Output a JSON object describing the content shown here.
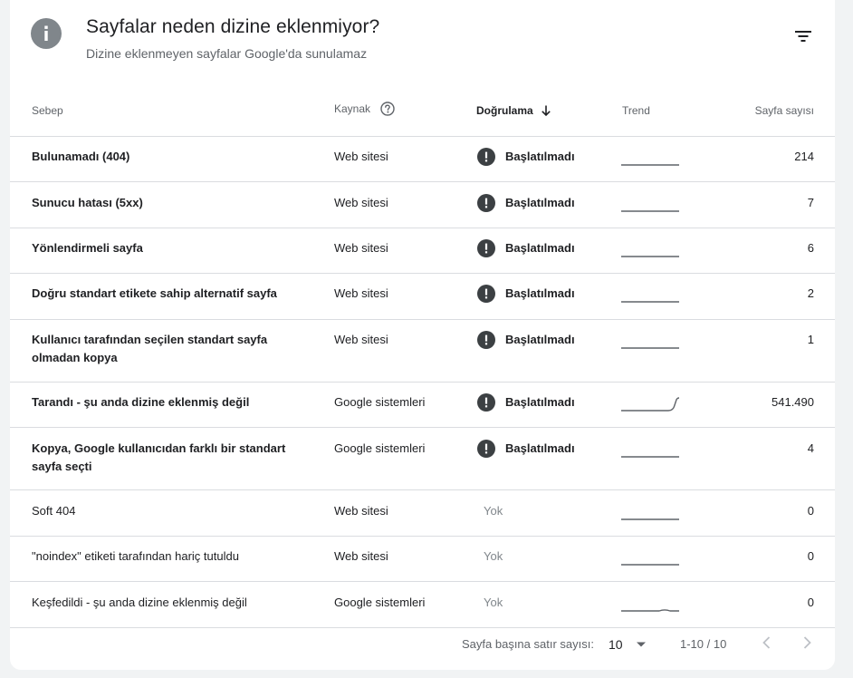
{
  "header": {
    "title": "Sayfalar neden dizine eklenmiyor?",
    "subtitle": "Dizine eklenmeyen sayfalar Google'da sunulamaz",
    "info_icon": "info-icon",
    "filter_icon": "filter-icon"
  },
  "table": {
    "columns": {
      "reason": "Sebep",
      "source": "Kaynak",
      "validation": "Doğrulama",
      "trend": "Trend",
      "count": "Sayfa sayısı"
    },
    "rows": [
      {
        "reason": "Bulunamadı (404)",
        "source": "Web sitesi",
        "validation": "Başlatılmadı",
        "trend": "flat",
        "count": "214"
      },
      {
        "reason": "Sunucu hatası (5xx)",
        "source": "Web sitesi",
        "validation": "Başlatılmadı",
        "trend": "flat",
        "count": "7"
      },
      {
        "reason": "Yönlendirmeli sayfa",
        "source": "Web sitesi",
        "validation": "Başlatılmadı",
        "trend": "flat",
        "count": "6"
      },
      {
        "reason": "Doğru standart etikete sahip alternatif sayfa",
        "source": "Web sitesi",
        "validation": "Başlatılmadı",
        "trend": "flat",
        "count": "2"
      },
      {
        "reason": "Kullanıcı tarafından seçilen standart sayfa olmadan kopya",
        "source": "Web sitesi",
        "validation": "Başlatılmadı",
        "trend": "flat",
        "count": "1"
      },
      {
        "reason": "Tarandı - şu anda dizine eklenmiş değil",
        "source": "Google sistemleri",
        "validation": "Başlatılmadı",
        "trend": "rise",
        "count": "541.490"
      },
      {
        "reason": "Kopya, Google kullanıcıdan farklı bir standart sayfa seçti",
        "source": "Google sistemleri",
        "validation": "Başlatılmadı",
        "trend": "flat",
        "count": "4"
      },
      {
        "reason": "Soft 404",
        "source": "Web sitesi",
        "validation": "Yok",
        "trend": "flat",
        "count": "0"
      },
      {
        "reason": "\"noindex\" etiketi tarafından hariç tutuldu",
        "source": "Web sitesi",
        "validation": "Yok",
        "trend": "flat",
        "count": "0"
      },
      {
        "reason": "Keşfedildi - şu anda dizine eklenmiş değil",
        "source": "Google sistemleri",
        "validation": "Yok",
        "trend": "bump",
        "count": "0"
      }
    ]
  },
  "footer": {
    "rows_per_page_label": "Sayfa başına satır sayısı:",
    "rows_per_page_value": "10",
    "range": "1-10 / 10"
  },
  "colors": {
    "alert": "#3c4043",
    "muted": "#80868b",
    "divider": "#dadce0",
    "info_icon_bg": "#80868b"
  }
}
